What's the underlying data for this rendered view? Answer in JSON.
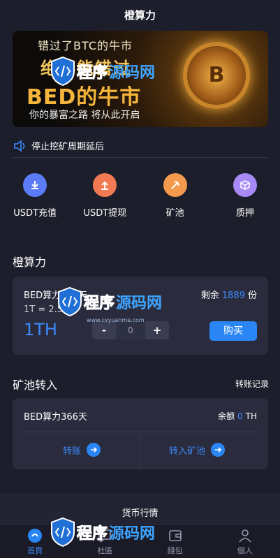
{
  "header": {
    "title": "橙算力"
  },
  "banner": {
    "line1": "错过了BTC的牛市",
    "line2": "绝不能错过",
    "line3": "BED的牛市",
    "line4": "你的暴富之路 将从此开启"
  },
  "notice": {
    "text": "停止挖矿周期延后"
  },
  "quick_actions": [
    {
      "label": "USDT充值",
      "icon": "download-icon",
      "color": "#5b7cf6"
    },
    {
      "label": "USDT提现",
      "icon": "upload-icon",
      "color": "#f27a52"
    },
    {
      "label": "矿池",
      "icon": "pickaxe-icon",
      "color": "#f39a4c"
    },
    {
      "label": "质押",
      "icon": "cube-icon",
      "color": "#a78af5"
    }
  ],
  "power": {
    "section_title": "橙算力",
    "product_name": "BED算力366天",
    "remain_label": "剩余",
    "remain_value": "1889",
    "remain_unit": "份",
    "rate": "1T = 2.50U",
    "unit_big": "1TH",
    "stepper_minus": "-",
    "stepper_value": "0",
    "stepper_plus": "+",
    "buy_label": "购买"
  },
  "pool": {
    "section_title": "矿池转入",
    "record_link": "转账记录",
    "product_name": "BED算力366天",
    "balance_label": "余额",
    "balance_value": "0",
    "balance_unit": "TH",
    "transfer_label": "转账",
    "into_pool_label": "转入矿池"
  },
  "market": {
    "title": "货币行情"
  },
  "tabbar": [
    {
      "label": "首頁",
      "icon": "home-icon",
      "active": true
    },
    {
      "label": "社區",
      "icon": "community-icon",
      "active": false
    },
    {
      "label": "錢包",
      "icon": "wallet-icon",
      "active": false
    },
    {
      "label": "個人",
      "icon": "user-icon",
      "active": false
    }
  ],
  "watermark": {
    "text1": "程序",
    "text2": "源码网",
    "sub": "www.cxyuanma.com"
  },
  "colors": {
    "accent": "#3d8bff",
    "background": "#1d1e2b",
    "card": "#2a2c3e"
  }
}
